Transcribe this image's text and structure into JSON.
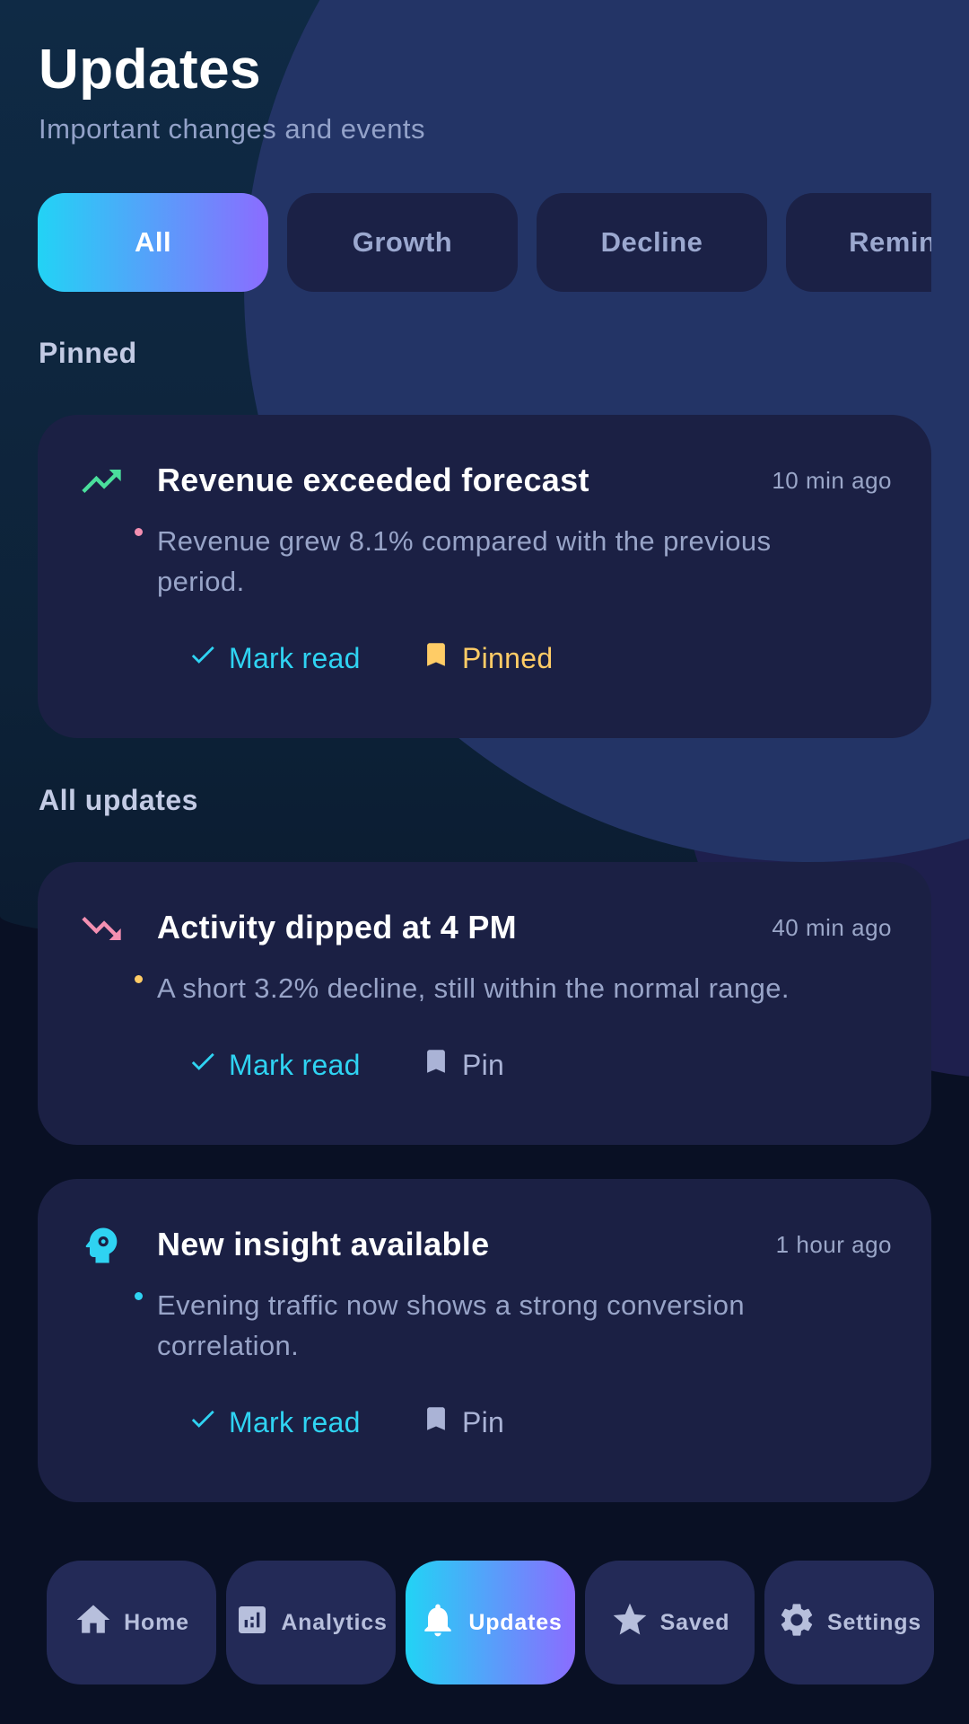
{
  "header": {
    "title": "Updates",
    "subtitle": "Important changes and events"
  },
  "filters": [
    {
      "label": "All",
      "active": true
    },
    {
      "label": "Growth",
      "active": false
    },
    {
      "label": "Decline",
      "active": false
    },
    {
      "label": "Remind",
      "active": false
    }
  ],
  "sections": {
    "pinned": "Pinned",
    "all_updates": "All updates"
  },
  "cards": [
    {
      "icon": "trending-up-icon",
      "icon_color": "#4ade9c",
      "dot_color": "#f48fb1",
      "title": "Revenue exceeded forecast",
      "time": "10 min ago",
      "body": "Revenue grew 8.1% compared with the previous period.",
      "mark_read": "Mark read",
      "pin_label": "Pinned",
      "pinned": true
    },
    {
      "icon": "trending-down-icon",
      "icon_color": "#f48fb1",
      "dot_color": "#ffcc66",
      "title": "Activity dipped at 4 PM",
      "time": "40 min ago",
      "body": "A short 3.2% decline, still within the normal range.",
      "mark_read": "Mark read",
      "pin_label": "Pin",
      "pinned": false
    },
    {
      "icon": "insight-head-icon",
      "icon_color": "#2fd3f2",
      "dot_color": "#2fd3f2",
      "title": "New insight available",
      "time": "1 hour ago",
      "body": "Evening traffic now shows a strong conversion correlation.",
      "mark_read": "Mark read",
      "pin_label": "Pin",
      "pinned": false
    }
  ],
  "nav": [
    {
      "label": "Home",
      "icon": "home-icon",
      "active": false
    },
    {
      "label": "Analytics",
      "icon": "analytics-icon",
      "active": false
    },
    {
      "label": "Updates",
      "icon": "bell-icon",
      "active": true
    },
    {
      "label": "Saved",
      "icon": "star-icon",
      "active": false
    },
    {
      "label": "Settings",
      "icon": "gear-icon",
      "active": false
    }
  ],
  "colors": {
    "accent_start": "#22d3f5",
    "accent_end": "#8b6cff",
    "card_bg": "#1b2044",
    "pinned_color": "#ffcc66",
    "read_color": "#2fd3f2"
  }
}
